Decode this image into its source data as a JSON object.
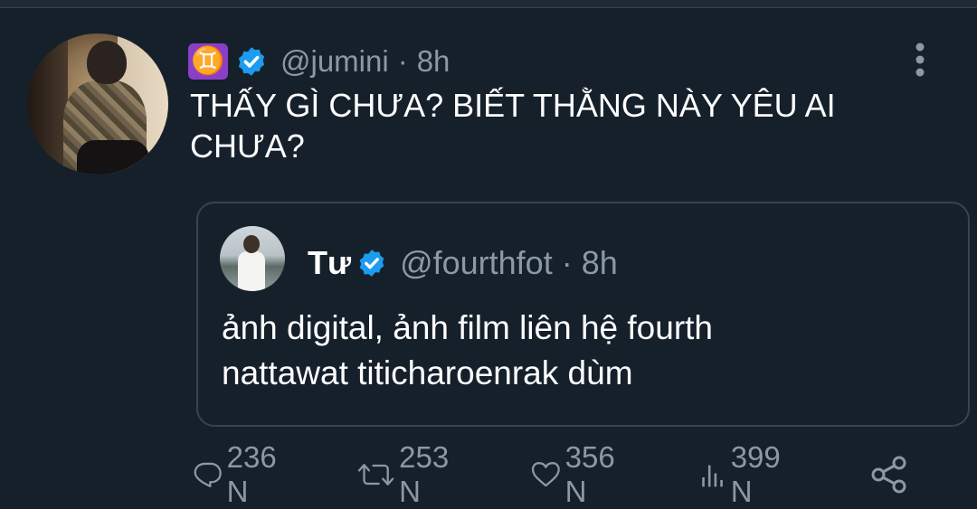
{
  "tweet": {
    "badge_glyph": "♊",
    "handle": "@jumini",
    "separator": "·",
    "time": "8h",
    "text": "THẤY GÌ CHƯA? BIẾT THẰNG NÀY YÊU AI\nCHƯA?"
  },
  "quote": {
    "name": "Tư",
    "handle": "@fourthfot",
    "separator": "·",
    "time": "8h",
    "text": "ảnh digital, ảnh film liên hệ fourth\nnattawat titicharoenrak dùm"
  },
  "actions": {
    "reply_count": "236 N",
    "retweet_count": "253 N",
    "like_count": "356 N",
    "views_count": "399 N"
  },
  "colors": {
    "background": "#15202b",
    "secondary_text": "#8b98a5",
    "border": "#38444d",
    "verified": "#1d9bf0",
    "badge": "#8b3fc9"
  },
  "icons": [
    "gemini-badge",
    "verified-icon",
    "more-icon",
    "reply-icon",
    "retweet-icon",
    "like-icon",
    "views-icon",
    "share-icon"
  ]
}
